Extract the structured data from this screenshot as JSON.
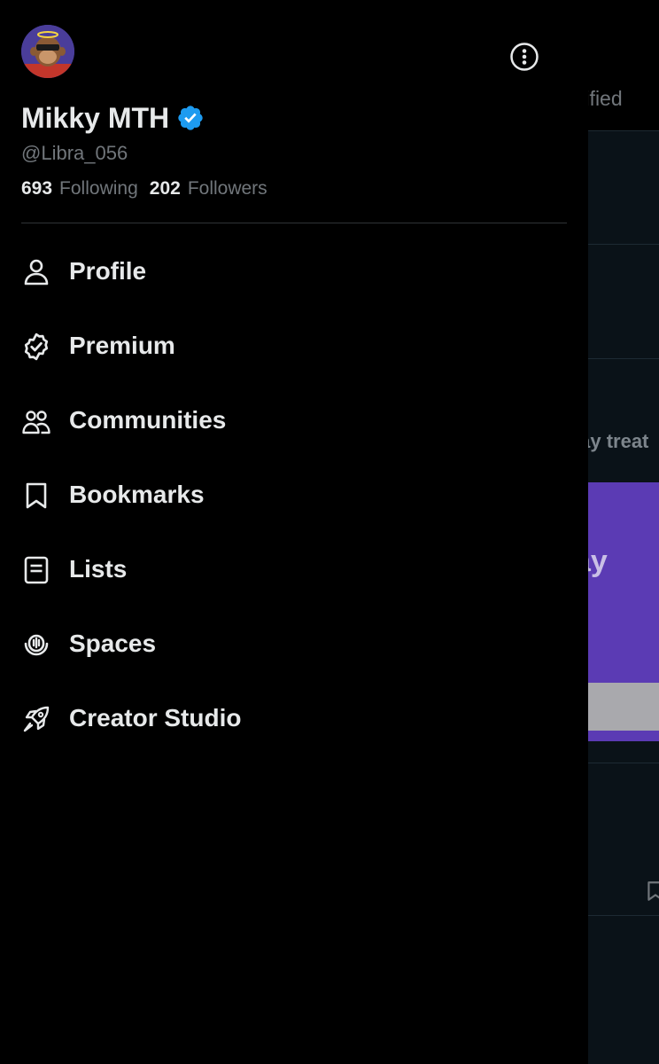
{
  "background": {
    "tab_partial": "erified",
    "snippet_partial": "lay treat",
    "promo_partial": "ay"
  },
  "profile": {
    "avatar": "bored-ape-avatar",
    "display_name": "Mikky MTH",
    "verified": true,
    "handle": "@Libra_056",
    "following_count": "693",
    "following_label": "Following",
    "followers_count": "202",
    "followers_label": "Followers"
  },
  "menu": {
    "more_icon": "more-circle-icon",
    "items": [
      {
        "label": "Profile",
        "icon": "person-icon"
      },
      {
        "label": "Premium",
        "icon": "verified-badge-icon"
      },
      {
        "label": "Communities",
        "icon": "people-icon"
      },
      {
        "label": "Bookmarks",
        "icon": "bookmark-icon"
      },
      {
        "label": "Lists",
        "icon": "list-icon"
      },
      {
        "label": "Spaces",
        "icon": "microphone-icon"
      },
      {
        "label": "Creator Studio",
        "icon": "rocket-icon"
      }
    ]
  },
  "colors": {
    "background": "#000000",
    "text_primary": "#e7e9ea",
    "text_secondary": "#71767b",
    "verified_blue": "#1d9bf0",
    "divider": "#2f3336",
    "promo_purple": "#5b3bb4"
  }
}
